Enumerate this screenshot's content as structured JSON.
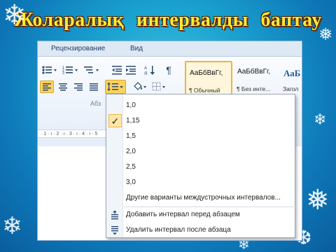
{
  "slide": {
    "title": "Жоларалық  интервалды баптау"
  },
  "ribbon": {
    "tabs": [
      "Рецензирование",
      "Вид"
    ],
    "group_label": "Абз",
    "ruler_text": "·  1 · ı · 2 · ı · 3 · ı · 4 · ı · 5",
    "styles": [
      {
        "sample": "АаБбВвГг,",
        "name": "¶ Обычный",
        "selected": true
      },
      {
        "sample": "АаБбВвГг,",
        "name": "¶ Без инте...",
        "selected": false
      },
      {
        "sample": "АаБ",
        "name": "Загол",
        "selected": false
      }
    ],
    "paragraph_mark": "¶"
  },
  "dropdown": {
    "options": [
      "1,0",
      "1,15",
      "1,5",
      "2,0",
      "2,5",
      "3,0"
    ],
    "selected": "1,15",
    "checkmark": "✓",
    "more_options": "Другие варианты междустрочных интервалов...",
    "add_before": "Добавить интервал перед абзацем",
    "remove_after": "Удалить интервал после абзаца"
  },
  "colors": {
    "title": "#ffe93a",
    "background": "#1aa2d0",
    "highlight": "#ffd35a"
  }
}
